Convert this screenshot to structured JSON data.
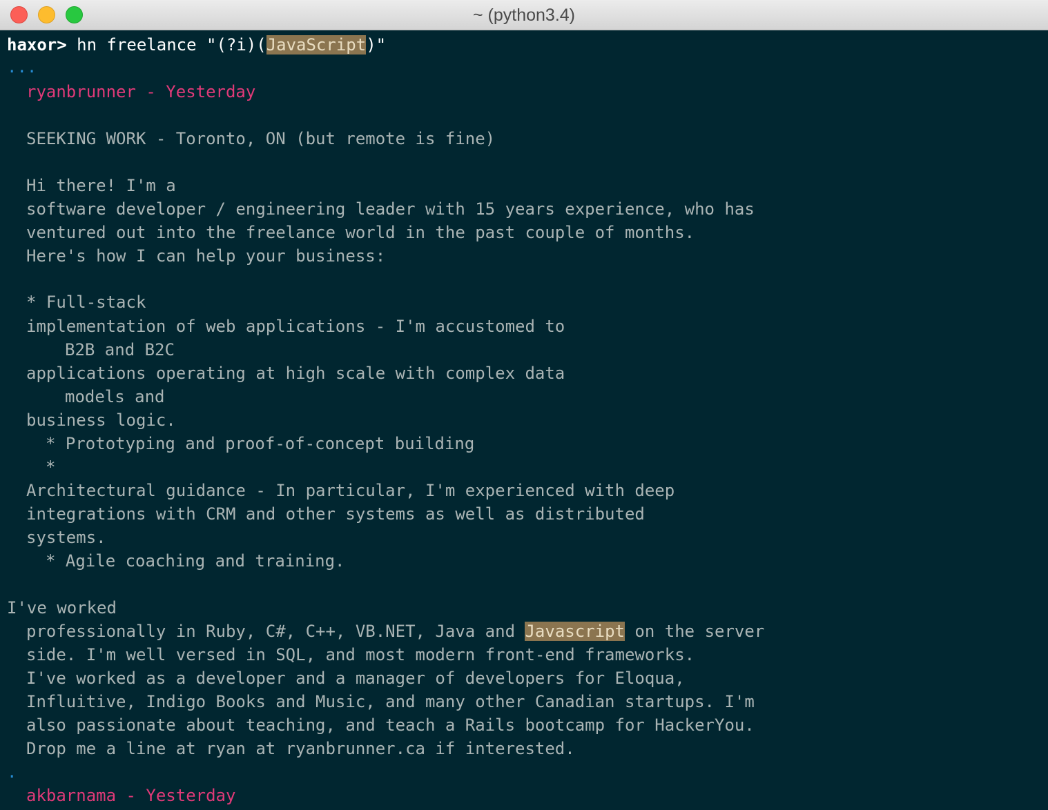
{
  "window": {
    "title": "~ (python3.4)"
  },
  "terminal": {
    "prompt": "haxor>",
    "command_before": " hn freelance \"(?i)(",
    "command_highlight": "JavaScript",
    "command_after": ")\"",
    "ellipsis": "...",
    "post1": {
      "header": "ryanbrunner - Yesterday",
      "lines": [
        "SEEKING WORK - Toronto, ON (but remote is fine)",
        "Hi there! I'm a",
        "software developer / engineering leader with 15 years experience, who has",
        "ventured out into the freelance world in the past couple of months.",
        "Here's how I can help your business:",
        "* Full-stack",
        "implementation of web applications - I'm accustomed to",
        "B2B and B2C",
        "applications operating at high scale with complex data",
        "models and",
        "business logic.",
        "* Prototyping and proof-of-concept building",
        "*",
        "Architectural guidance - In particular, I'm experienced with deep",
        "integrations with CRM and other systems as well as distributed",
        "systems.",
        "* Agile coaching and training.",
        "I've worked"
      ],
      "hl_line_before": "professionally in Ruby, C#, C++, VB.NET, Java and ",
      "hl_line_highlight": "Javascript",
      "hl_line_after": " on the server",
      "tail_lines": [
        "side. I'm well versed in SQL, and most modern front-end frameworks.",
        "I've worked as a developer and a manager of developers for Eloqua,",
        "Influitive, Indigo Books and Music, and many other Canadian startups. I'm",
        "also passionate about teaching, and teach a Rails bootcamp for HackerYou.",
        "Drop me a line at ryan at ryanbrunner.ca if interested."
      ]
    },
    "separator": ".",
    "post2": {
      "header": "akbarnama - Yesterday"
    }
  }
}
